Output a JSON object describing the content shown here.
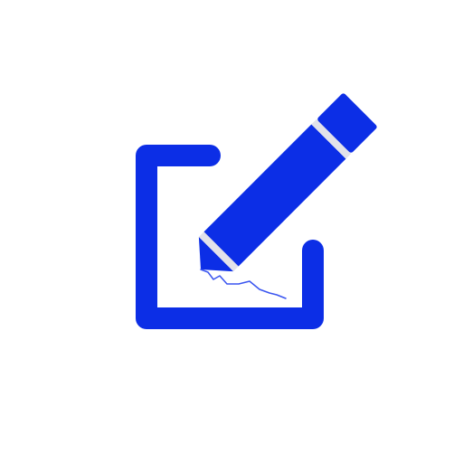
{
  "icon": {
    "name": "edit-compose-icon",
    "colors": {
      "primary": "#0c2ee6",
      "background": "#ffffff",
      "pencil_band": "#e2e2ea",
      "ink_stroke": "#3a55f0"
    }
  }
}
